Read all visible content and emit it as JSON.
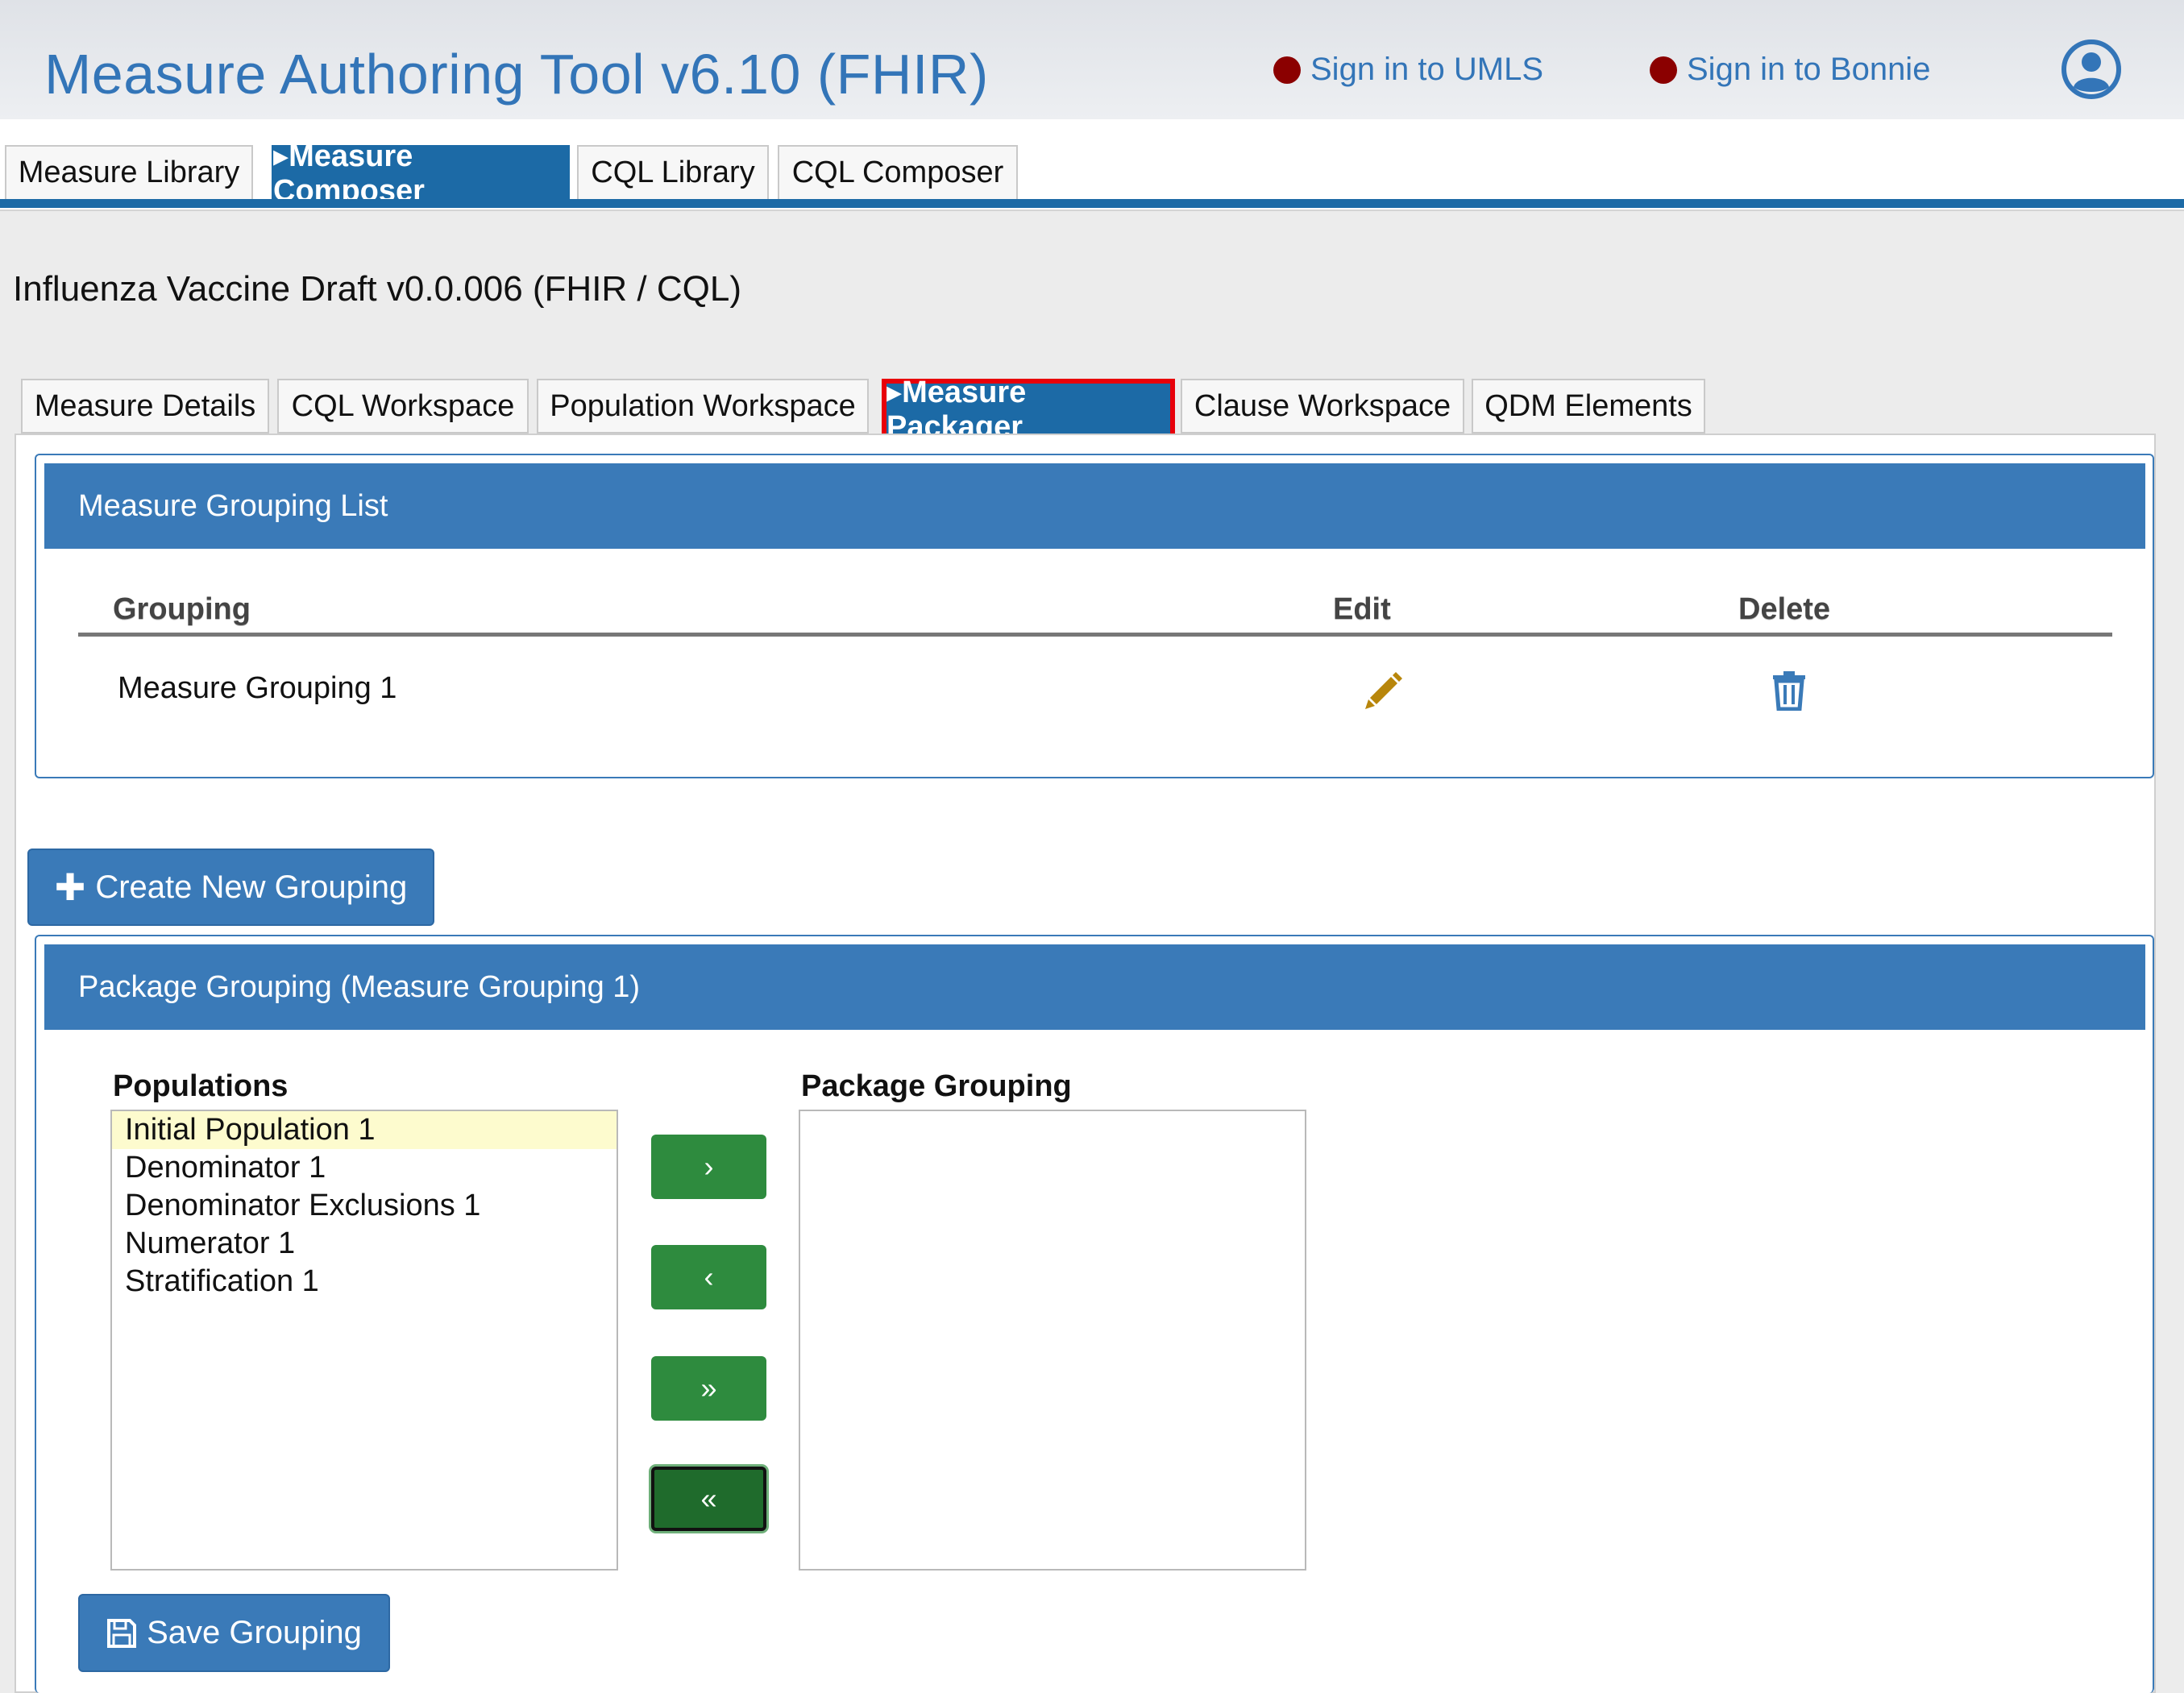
{
  "header": {
    "app_title": "Measure Authoring Tool v6.10 (FHIR)",
    "sign_in_umls": "Sign in to UMLS",
    "sign_in_bonnie": "Sign in to Bonnie",
    "status_dot_color": "#8b0000",
    "user_icon": "user-circle-icon"
  },
  "top_nav": {
    "tabs": [
      {
        "label": "Measure Library"
      },
      {
        "label": "▸Measure Composer",
        "active": true
      },
      {
        "label": "CQL Library"
      },
      {
        "label": "CQL Composer"
      }
    ]
  },
  "measure": {
    "title": "Influenza Vaccine Draft v0.0.006 (FHIR / CQL)"
  },
  "sub_tabs": [
    {
      "label": "Measure Details"
    },
    {
      "label": "CQL Workspace"
    },
    {
      "label": "Population Workspace"
    },
    {
      "label": "▸Measure Packager",
      "active": true
    },
    {
      "label": "Clause Workspace"
    },
    {
      "label": "QDM Elements"
    }
  ],
  "grouping_list": {
    "title": "Measure Grouping List",
    "columns": [
      "Grouping",
      "Edit",
      "Delete"
    ],
    "rows": [
      {
        "grouping": "Measure Grouping 1",
        "edit_icon": "pencil-icon",
        "delete_icon": "trash-icon"
      }
    ]
  },
  "create_button": {
    "label": "Create New Grouping",
    "icon": "plus-icon"
  },
  "package_grouping": {
    "title": "Package Grouping (Measure Grouping 1)",
    "populations_label": "Populations",
    "package_label": "Package Grouping",
    "populations": [
      "Initial Population 1",
      "Denominator 1",
      "Denominator Exclusions 1",
      "Numerator 1",
      "Stratification 1"
    ],
    "selected_population": "Initial Population 1",
    "package_items": [],
    "move_buttons": [
      "›",
      "‹",
      "»",
      "«"
    ]
  },
  "save_button": {
    "label": "Save Grouping",
    "icon": "floppy-disk-icon"
  },
  "colors": {
    "primary_blue": "#3a7ab8",
    "nav_blue": "#1c6aa6",
    "active_highlight": "#e8000a",
    "green": "#2e8b3e",
    "edit_icon": "#b8860b",
    "selection": "#fdfbce"
  }
}
